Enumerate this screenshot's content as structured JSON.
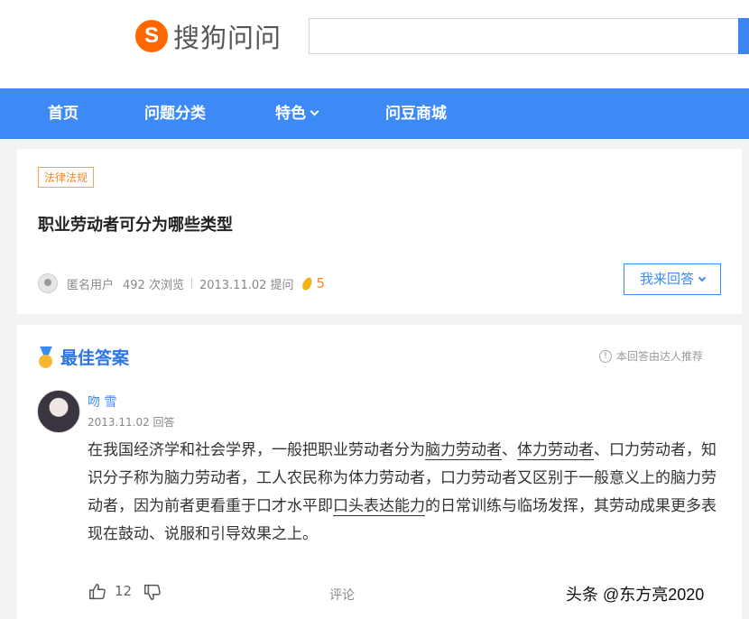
{
  "header": {
    "logo_mark": "S",
    "logo_text": "搜狗问问"
  },
  "search": {
    "placeholder": "",
    "value": ""
  },
  "nav": {
    "items": [
      {
        "label": "首页"
      },
      {
        "label": "问题分类"
      },
      {
        "label": "特色"
      },
      {
        "label": "问豆商城"
      }
    ]
  },
  "question": {
    "tag": "法律法规",
    "title": "职业劳动者可分为哪些类型",
    "asker": "匿名用户",
    "views": "492 次浏览",
    "date": "2013.11.02 提问",
    "bounty": "5",
    "answer_button": "我来回答"
  },
  "answer": {
    "badge": "最佳答案",
    "recommend_note": "本回答由达人推荐",
    "author": "吻 雪",
    "date": "2013.11.02 回答",
    "body": {
      "p1": "在我国经济学和社会学界，一般把职业劳动者分为",
      "u1": "脑力劳动者",
      "p2": "、",
      "u2": "体力劳动者",
      "p3": "、口力劳动者，知识分子称为脑力劳动者，工人农民称为体力劳动者，口力劳动者又区别于一般意义上的脑力劳动者，因为前者更看重于口才水平即",
      "u3": "口头表达能力",
      "p4": "的日常训练与临场发挥，其劳动成果更多表现在鼓动、说服和引导效果之上。"
    },
    "likes": "12",
    "comment_label": "评论"
  },
  "watermark": "头条 @东方亮2020",
  "colors": {
    "brand_orange": "#fe6700",
    "nav_blue": "#3d8af7",
    "tag_orange": "#f08a2c"
  }
}
